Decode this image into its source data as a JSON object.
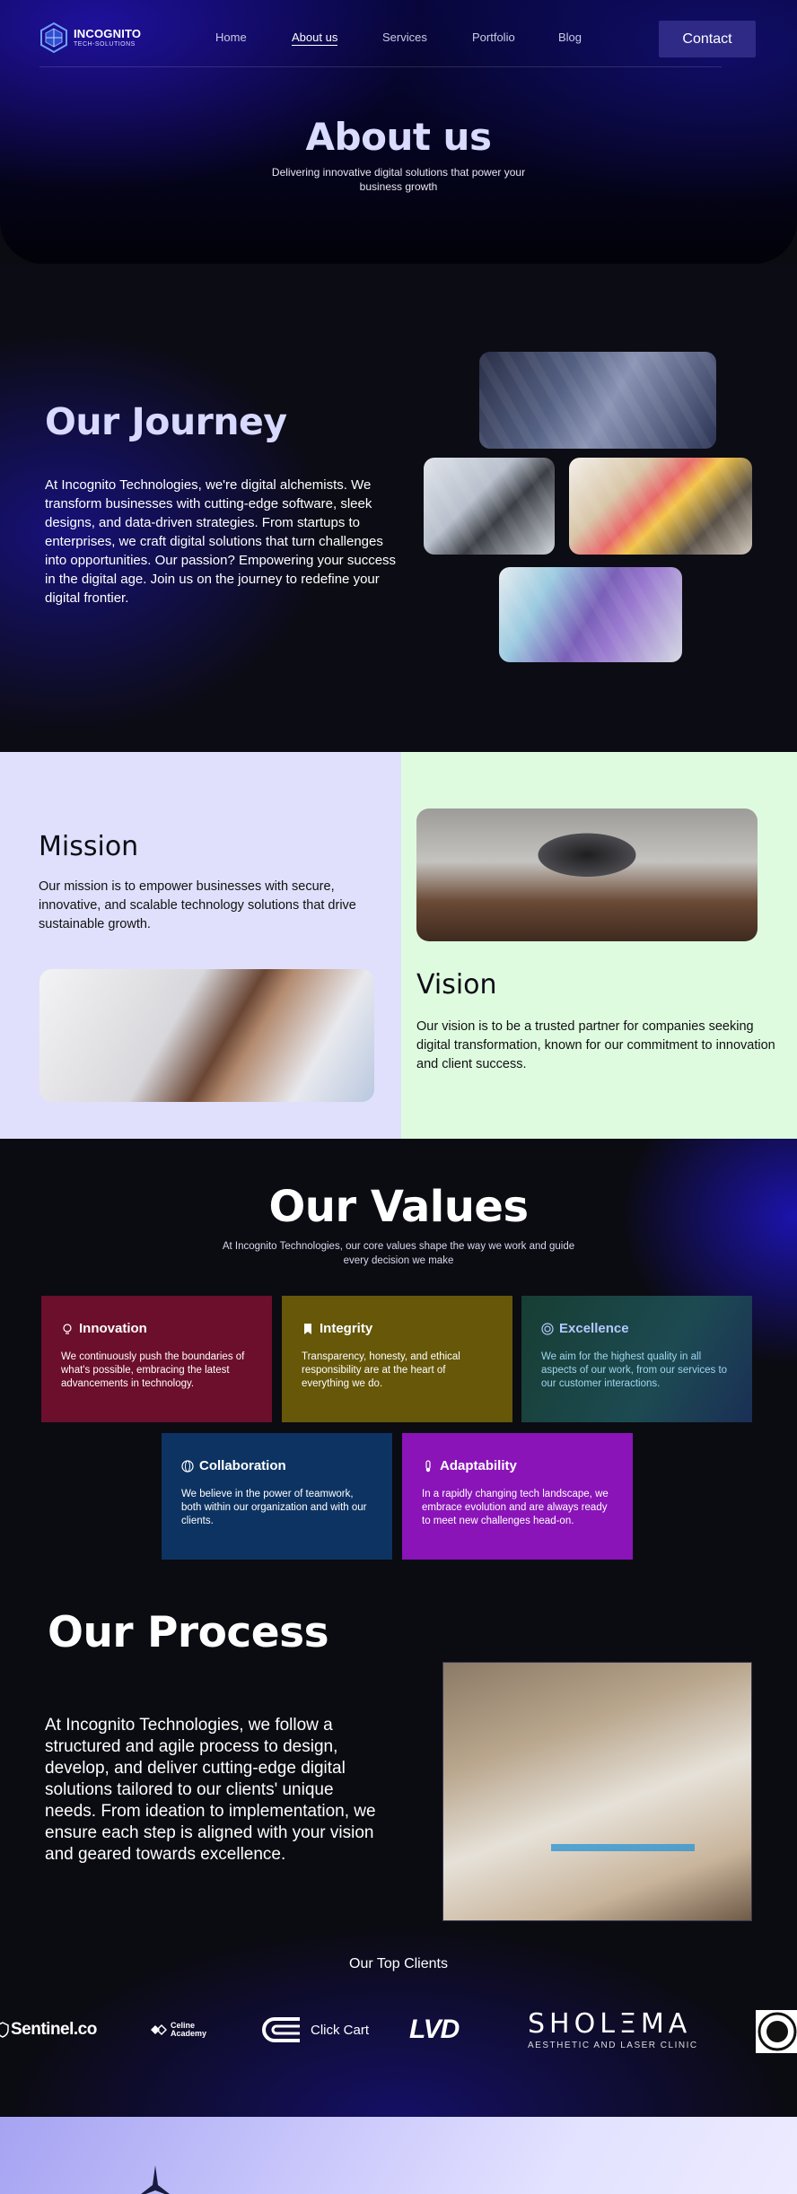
{
  "header": {
    "logo": {
      "name": "INCOGNITO",
      "tagline": "TECH-SOLUTIONS"
    },
    "nav": [
      {
        "label": "Home",
        "active": false
      },
      {
        "label": "About us",
        "active": true
      },
      {
        "label": "Services",
        "active": false
      },
      {
        "label": "Portfolio",
        "active": false
      },
      {
        "label": "Blog",
        "active": false
      }
    ],
    "contact_label": "Contact"
  },
  "hero": {
    "title": "About us",
    "subtitle": "Delivering innovative digital solutions that power your business growth"
  },
  "journey": {
    "title": "Our Journey",
    "body": "At Incognito Technologies, we're digital alchemists. We transform businesses with cutting-edge software, sleek designs, and data-driven strategies. From startups to enterprises, we craft digital solutions that turn challenges into opportunities. Our passion? Empowering your success in the digital age. Join us on the journey to redefine your digital frontier."
  },
  "mission": {
    "title": "Mission",
    "body": "Our mission is to empower businesses with secure, innovative, and scalable technology solutions that drive sustainable growth."
  },
  "vision": {
    "title": "Vision",
    "body": "Our vision is to be a trusted partner for companies seeking digital transformation, known for our commitment to innovation and client success."
  },
  "values": {
    "title": "Our Values",
    "subtitle": "At Incognito Technologies, our core values shape the way we work and guide every decision we make",
    "cards": [
      {
        "title": "Innovation",
        "icon": "lightbulb-icon",
        "color": "#6b0f2c",
        "body": "We continuously push the boundaries of what's possible, embracing the latest advancements in technology."
      },
      {
        "title": "Integrity",
        "icon": "bookmark-icon",
        "color": "#665709",
        "body": "Transparency, honesty, and ethical responsibility are at the heart of everything we do."
      },
      {
        "title": "Excellence",
        "icon": "target-icon",
        "color": "#1d4a52",
        "body": "We aim for the highest quality in all aspects of our work, from our services to our customer interactions."
      },
      {
        "title": "Collaboration",
        "icon": "globe-icon",
        "color": "#0d3362",
        "body": "We believe in the power of teamwork, both within our organization and with our clients."
      },
      {
        "title": "Adaptability",
        "icon": "thermometer-icon",
        "color": "#8a14b8",
        "body": "In a rapidly changing tech landscape, we embrace evolution and are always ready to meet new challenges head-on."
      }
    ]
  },
  "process": {
    "title": "Our Process",
    "body": "At Incognito Technologies, we follow a structured and agile process to design, develop, and deliver cutting-edge digital solutions tailored to our clients' unique needs. From ideation to implementation, we ensure each step is aligned with your vision and geared towards excellence."
  },
  "clients": {
    "title": "Our Top Clients",
    "logos": {
      "sentinel": "Sentinel.co",
      "celine_line1": "Celine",
      "celine_line2": "Academy",
      "clickcart": "Click Cart",
      "lvd": "LVD",
      "sholema": "SHOLΞMA",
      "sholema_sub": "AESTHETIC AND LASER CLINIC"
    }
  },
  "colors": {
    "accent": "#2e2a86",
    "hero_title": "#d9dbff",
    "mission_bg": "#e0e0fd",
    "vision_bg": "#defbe0"
  }
}
